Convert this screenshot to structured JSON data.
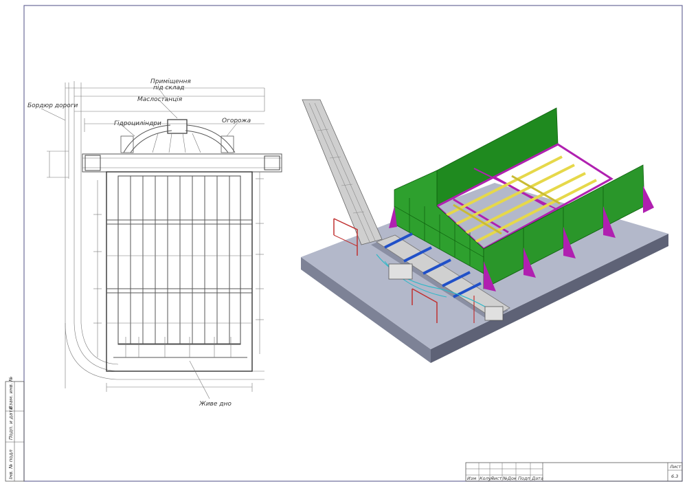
{
  "drawing": {
    "labels": {
      "road_border": "Бордюр дороги",
      "annex": "Приміщення",
      "annex_sub": "під склад",
      "oil_station": "Маслостанція",
      "hydro_cylinders": "Гідроциліндри",
      "fence": "Огорожа",
      "live_floor": "Живе дно"
    }
  },
  "side_stamp": {
    "inv_no": "Інв. № подл",
    "sign_date": "Подп. и дата",
    "replace_inv": "Взам. инв. №"
  },
  "title_block": {
    "columns": [
      "Изм",
      "Колуч",
      "Лист",
      "№Док",
      "Подп",
      "Дата"
    ],
    "sheet_label": "Лист",
    "sheet_number": "6.3"
  },
  "colors": {
    "frame": "#6b6b9a",
    "slab": "#a9aec1",
    "green_panel": "#1f8a1f",
    "magenta_frame": "#b020b0",
    "yellow_beam": "#e6d84a",
    "blue_cylinder": "#2050c8",
    "red_rail": "#c03030",
    "cyan_hose": "#30b8c8",
    "conveyor": "#c8c8c8"
  }
}
